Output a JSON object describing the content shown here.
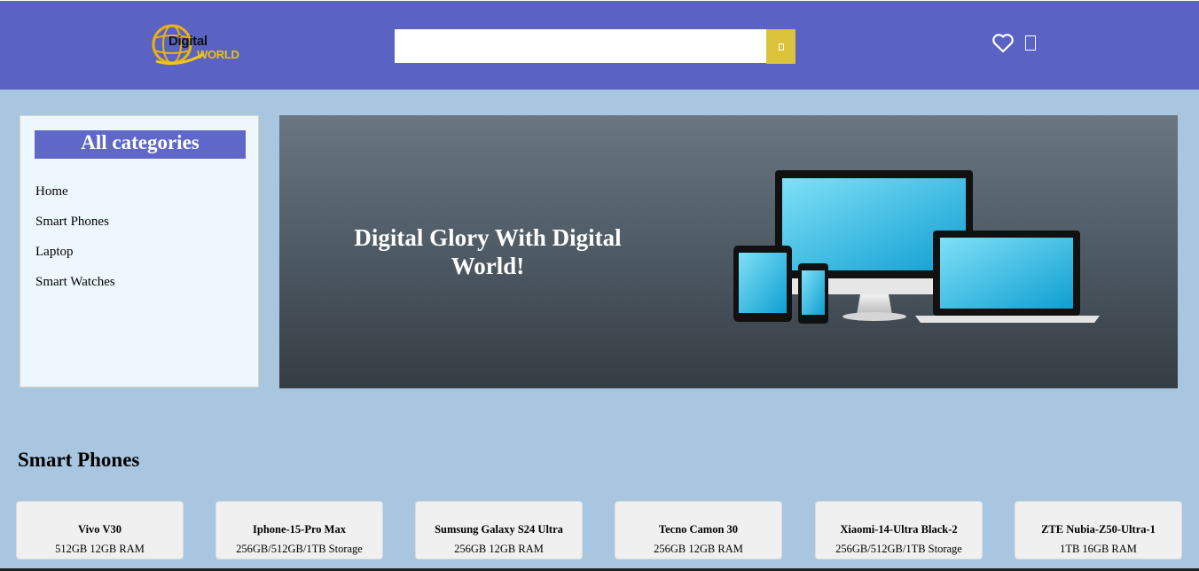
{
  "header": {
    "logo_line1": "Digital",
    "logo_line2": "WORLD",
    "search": {
      "placeholder": "",
      "value": ""
    },
    "icons": [
      "search-icon",
      "heart-icon",
      "cart-icon"
    ]
  },
  "categories": {
    "title": "All categories",
    "items": [
      "Home",
      "Smart Phones",
      "Laptop",
      "Smart Watches"
    ]
  },
  "banner": {
    "headline": "Digital Glory With Digital World!"
  },
  "section": {
    "title": "Smart Phones"
  },
  "products": [
    {
      "name": "Vivo V30",
      "spec": "512GB 12GB RAM"
    },
    {
      "name": "Iphone-15-Pro Max",
      "spec": "256GB/512GB/1TB Storage"
    },
    {
      "name": "Sumsung Galaxy S24 Ultra",
      "spec": "256GB 12GB RAM"
    },
    {
      "name": "Tecno Camon 30",
      "spec": "256GB 12GB RAM"
    },
    {
      "name": "Xiaomi-14-Ultra Black-2",
      "spec": "256GB/512GB/1TB Storage"
    },
    {
      "name": "ZTE Nubia-Z50-Ultra-1",
      "spec": "1TB 16GB RAM"
    }
  ],
  "colors": {
    "header_bg": "#5a62c3",
    "page_bg": "#a9c6e1",
    "accent_yellow": "#dcc33c",
    "category_title_bg": "#5f67c8"
  }
}
